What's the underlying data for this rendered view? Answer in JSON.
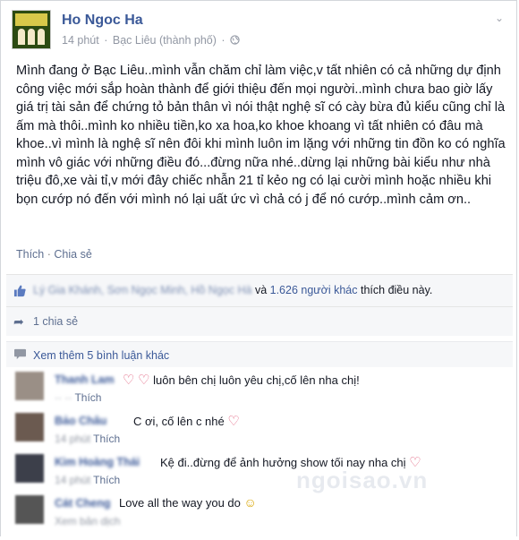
{
  "post": {
    "author": "Ho Ngoc Ha",
    "time": "14 phút",
    "separator": "·",
    "location": "Bạc Liêu (thành phố)",
    "privacy_icon": "globe-icon",
    "text": "Mình đang ở Bạc Liêu..mình vẫn chăm chỉ làm việc,v tất nhiên có cả những dự định công việc mới sắp hoàn thành để giới thiệu đến mọi người..mình chưa bao giờ lấy giá trị tài sản để chứng tỏ bản thân vì nói thật nghệ sĩ có cày bừa đủ kiểu cũng chỉ là ấm mà thôi..mình ko nhiều tiền,ko xa hoa,ko khoe khoang vì tất nhiên có đâu mà khoe..vì mình là nghệ sĩ nên đôi khi mình luôn im lặng với những tin đồn ko có nghĩa mình vô giác với những điều đó...đừng nữa nhé..dừng lại những bài kiểu như nhà triệu đô,xe vài tỉ,v mới đây chiếc nhẫn 21 tỉ kẻo ng có lại cười mình hoặc nhiều khi bọn cướp nó đến với mình nó lại uất ức vì chả có j để nó cướp..mình cảm ơn.."
  },
  "actions": {
    "like": "Thích",
    "dot": "·",
    "share": "Chia sẻ"
  },
  "likes": {
    "blurred_names": "Lý Gia Khánh, Sơn Ngọc Minh,",
    "name_last": "Hồ Ngọc Hà",
    "and": "và",
    "others_link": "1.626 người khác",
    "suffix": "thích điều này."
  },
  "shares": {
    "text": "1 chia sẻ"
  },
  "more_comments": "Xem thêm 5 bình luận khác",
  "comments": [
    {
      "name": "Thanh Lam",
      "text": "luôn bên chị luôn yêu chị,cố lên nha chị!",
      "sub_blur": "",
      "sub_link": "Thích"
    },
    {
      "name": "Bảo Châu",
      "text": "C ơi, cố lên c nhé",
      "sub_blur": "14 phút",
      "sub_link": "Thích"
    },
    {
      "name": "Kim Hoàng Thái",
      "text": "Kệ đi..đừng để ảnh hưởng show tối nay nha chị",
      "sub_blur": "14 phút",
      "sub_link": "Thích"
    },
    {
      "name": "Cát Cheng",
      "text": "Love all the way you do",
      "sub_blur": "Xem bản dịch",
      "sub_link": ""
    }
  ],
  "watermark": "ngoisao.vn",
  "colors": {
    "link": "#3b5998",
    "heart": "#e05b7a"
  }
}
